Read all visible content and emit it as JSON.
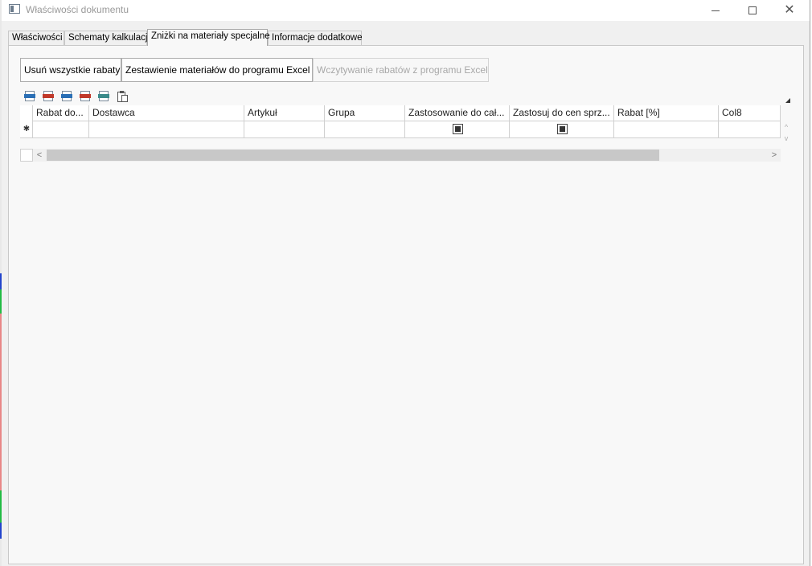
{
  "window": {
    "title": "Właściwości dokumentu",
    "controls": {
      "minimize": "minimize-icon",
      "maximize": "maximize-icon",
      "close": "close-icon"
    }
  },
  "tabs": [
    {
      "label": "Właściwości",
      "active": false
    },
    {
      "label": "Schematy kalkulacji",
      "active": false
    },
    {
      "label": "Zniżki na materiały specjalne",
      "active": true
    },
    {
      "label": "Informacje dodatkowe",
      "active": false
    }
  ],
  "buttons": {
    "remove_all": "Usuń wszystkie rabaty",
    "export_excel": "Zestawienie materiałów do programu Excel",
    "import_excel": "Wczytywanie rabatów z programu Excel"
  },
  "toolbar_icons": [
    "export-csv-icon",
    "export-pdf-icon",
    "export-doc-icon",
    "export-xls-icon",
    "export-xlsx-icon",
    "clipboard-icon"
  ],
  "grid": {
    "columns": [
      "Rabat do...",
      "Dostawca",
      "Artykuł",
      "Grupa",
      "Zastosowanie do cał...",
      "Zastosuj do cen sprz...",
      "Rabat [%]",
      "Col8"
    ],
    "new_row_marker": "✱",
    "new_row": {
      "zastosowanie_checked": true,
      "zastosuj_checked": true
    }
  },
  "colors": {
    "window_bg": "#f0f0f0",
    "panel_bg": "#f8f8f8",
    "border": "#c8c8c8",
    "disabled_text": "#a8a8a8"
  }
}
